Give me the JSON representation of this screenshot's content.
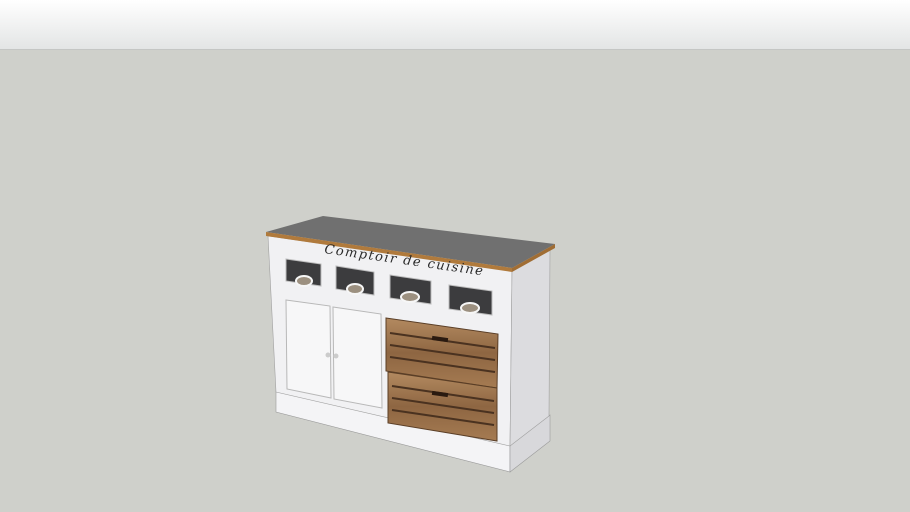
{
  "model": {
    "engraving": "Comptoir de cuisine",
    "colors": {
      "background": "#cfd0cb",
      "top": "#707070",
      "edge": "#b07a3c",
      "body": "#f1f1f3",
      "side": "#dcdcdf",
      "wood": "#9a7048"
    }
  }
}
